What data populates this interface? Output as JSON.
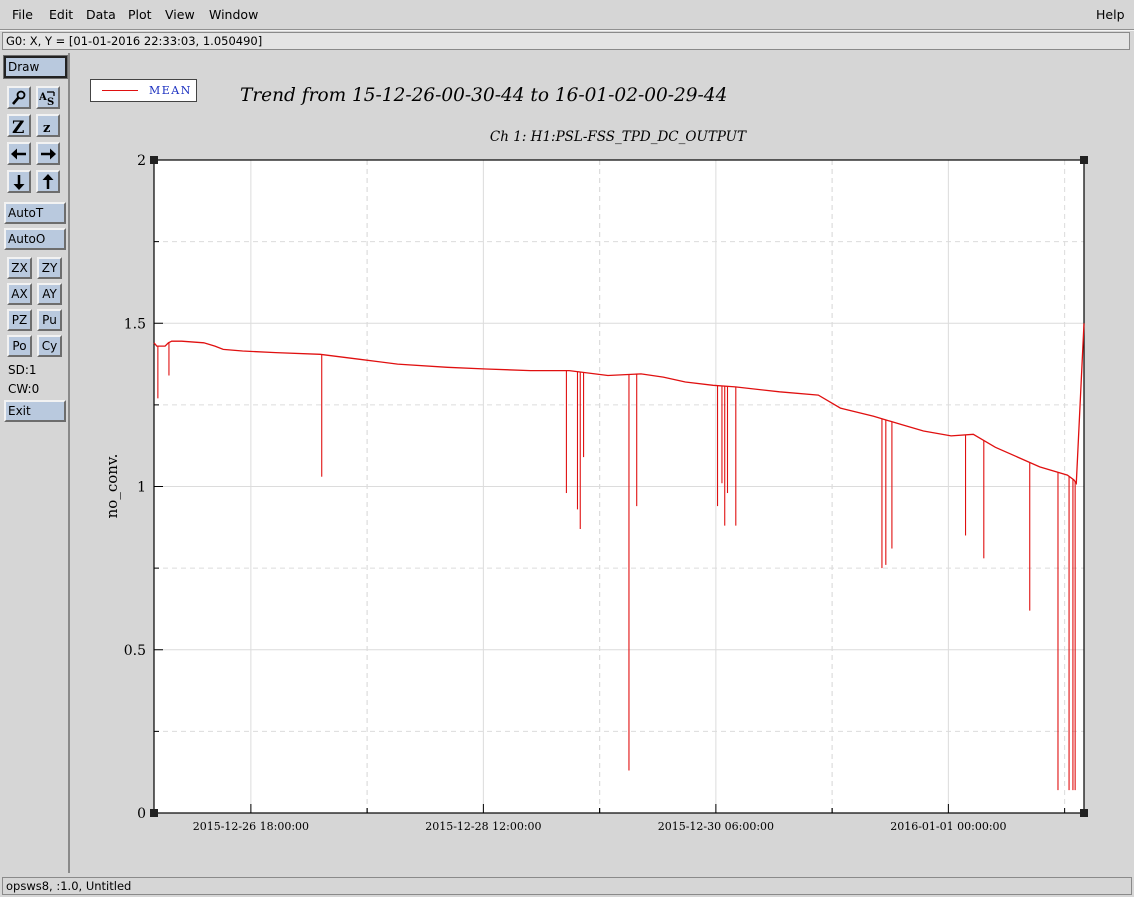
{
  "menubar": {
    "file": "File",
    "edit": "Edit",
    "data": "Data",
    "plot": "Plot",
    "view": "View",
    "window": "Window",
    "help": "Help"
  },
  "coord_readout": "G0: X, Y = [01-01-2016 22:33:03, 1.050490]",
  "toolbar": {
    "draw": "Draw",
    "autot": "AutoT",
    "autoo": "AutoO",
    "zx": "ZX",
    "zy": "ZY",
    "ax": "AX",
    "ay": "AY",
    "pz": "PZ",
    "pu": "Pu",
    "po": "Po",
    "cy": "Cy",
    "sd": "SD:1",
    "cw": "CW:0",
    "exit": "Exit",
    "icons": [
      "magnify-icon",
      "auto-scale-icon",
      "zoom-in-icon",
      "zoom-out-icon",
      "pan-left-icon",
      "pan-right-icon",
      "pan-down-icon",
      "pan-up-icon"
    ]
  },
  "legend": {
    "label": "MEAN",
    "color": "#e01010"
  },
  "plot_title": "Trend from 15-12-26-00-30-44 to 16-01-02-00-29-44",
  "status": "opsws8, :1.0, Untitled",
  "chart_data": {
    "type": "line",
    "title": "Trend from 15-12-26-00-30-44 to 16-01-02-00-29-44",
    "subtitle": "Ch 1: H1:PSL-FSS_TPD_DC_OUTPUT",
    "xlabel": "",
    "ylabel": "no_conv.",
    "x_start": "2015-12-26 00:30:44",
    "x_end": "2016-01-02 00:29:44",
    "xlim_hours": [
      0,
      168
    ],
    "x_ticks": [
      {
        "label": "2015-12-26 18:00:00",
        "hours": 17.5
      },
      {
        "label": "2015-12-28 12:00:00",
        "hours": 59.5
      },
      {
        "label": "2015-12-30 06:00:00",
        "hours": 101.5
      },
      {
        "label": "2016-01-01 00:00:00",
        "hours": 143.5
      }
    ],
    "ylim": [
      0,
      2
    ],
    "y_ticks": [
      0,
      0.5,
      1,
      1.5,
      2
    ],
    "grid": true,
    "legend_position": "top-left",
    "series": [
      {
        "name": "MEAN",
        "color": "#e01010",
        "x_hours": [
          0,
          0.5,
          2,
          2.6,
          3.2,
          5,
          9,
          11,
          12.5,
          16,
          22,
          30,
          37,
          44,
          53,
          60,
          68,
          75,
          82,
          88,
          92,
          96,
          101,
          105,
          113,
          120,
          124,
          130,
          135,
          139,
          144,
          148,
          152,
          156,
          160,
          165,
          166.2,
          166.6,
          168
        ],
        "y": [
          1.44,
          1.43,
          1.43,
          1.44,
          1.445,
          1.445,
          1.44,
          1.43,
          1.42,
          1.415,
          1.41,
          1.405,
          1.39,
          1.375,
          1.365,
          1.36,
          1.355,
          1.355,
          1.34,
          1.345,
          1.335,
          1.32,
          1.31,
          1.305,
          1.29,
          1.28,
          1.24,
          1.215,
          1.19,
          1.17,
          1.155,
          1.16,
          1.12,
          1.09,
          1.06,
          1.035,
          1.02,
          1.01,
          1.5
        ]
      }
    ],
    "dropouts": [
      {
        "x_hours": 0.7,
        "y": 1.27
      },
      {
        "x_hours": 2.7,
        "y": 1.34
      },
      {
        "x_hours": 30.3,
        "y": 1.03
      },
      {
        "x_hours": 74.5,
        "y": 0.98
      },
      {
        "x_hours": 76.5,
        "y": 0.93
      },
      {
        "x_hours": 77.0,
        "y": 0.87
      },
      {
        "x_hours": 77.6,
        "y": 1.09
      },
      {
        "x_hours": 85.8,
        "y": 0.13
      },
      {
        "x_hours": 87.2,
        "y": 0.94
      },
      {
        "x_hours": 101.8,
        "y": 0.94
      },
      {
        "x_hours": 102.6,
        "y": 1.01
      },
      {
        "x_hours": 103.1,
        "y": 0.88
      },
      {
        "x_hours": 103.6,
        "y": 0.98
      },
      {
        "x_hours": 105.1,
        "y": 0.88
      },
      {
        "x_hours": 131.5,
        "y": 0.75
      },
      {
        "x_hours": 132.2,
        "y": 0.76
      },
      {
        "x_hours": 133.3,
        "y": 0.81
      },
      {
        "x_hours": 146.6,
        "y": 0.85
      },
      {
        "x_hours": 149.9,
        "y": 0.78
      },
      {
        "x_hours": 158.2,
        "y": 0.62
      },
      {
        "x_hours": 163.3,
        "y": 0.07
      },
      {
        "x_hours": 165.3,
        "y": 0.07
      },
      {
        "x_hours": 166.0,
        "y": 0.07
      },
      {
        "x_hours": 166.4,
        "y": 0.07
      }
    ]
  }
}
